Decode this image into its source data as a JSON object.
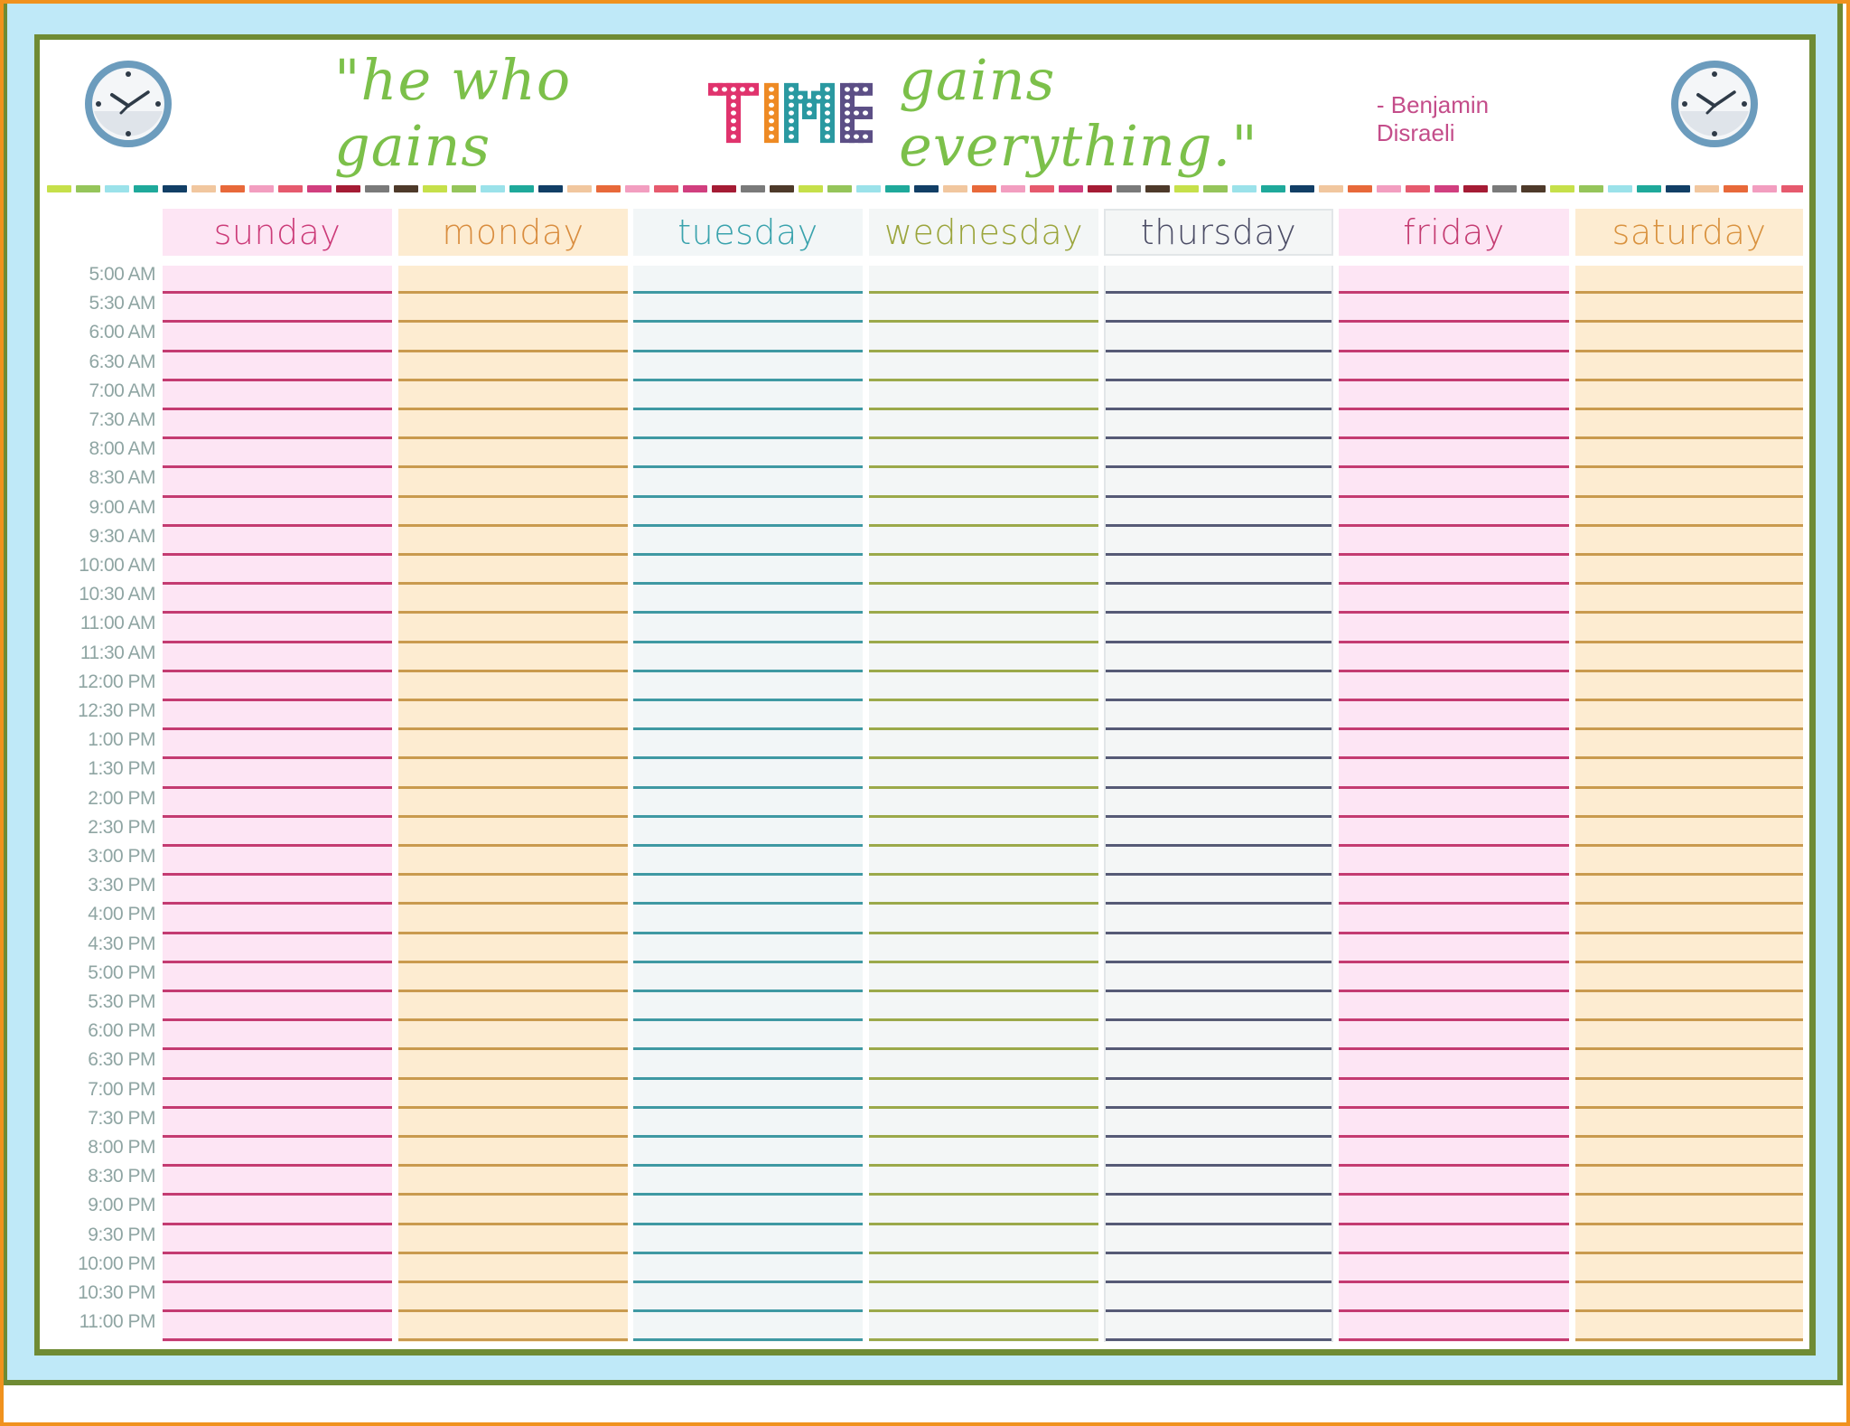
{
  "header": {
    "quote_before": "\"he who gains",
    "quote_emphasis": [
      "T",
      "I",
      "M",
      "E"
    ],
    "quote_emphasis_colors": [
      "#e0336d",
      "#ee8a24",
      "#2a99a1",
      "#5c4f86"
    ],
    "quote_after": "gains everything.\"",
    "author": "- Benjamin Disraeli",
    "clock_icon_left": "clock-icon",
    "clock_icon_right": "clock-icon"
  },
  "dash_colors": [
    "#c6e04a",
    "#95c55a",
    "#9be2ea",
    "#1fa99b",
    "#123f66",
    "#f1c79f",
    "#e8693a",
    "#f29ec0",
    "#e65a6e",
    "#d13f7f",
    "#a51c35",
    "#7a7a7a",
    "#4e3a2a"
  ],
  "days": [
    {
      "label": "sunday",
      "text_color": "#cc3c79",
      "bg": "#fde5f4",
      "line": "#c43b71",
      "header_border": false
    },
    {
      "label": "monday",
      "text_color": "#d98d3f",
      "bg": "#fdecd1",
      "line": "#c99a4e",
      "header_border": false
    },
    {
      "label": "tuesday",
      "text_color": "#3aa3ad",
      "bg": "#f2f6f7",
      "line": "#3f99a3",
      "header_border": false
    },
    {
      "label": "wednesday",
      "text_color": "#9ba53c",
      "bg": "#f3f6f6",
      "line": "#9ba94a",
      "header_border": false
    },
    {
      "label": "thursday",
      "text_color": "#4c4d66",
      "bg": "#f4f6f6",
      "line": "#565a76",
      "header_border": true
    },
    {
      "label": "friday",
      "text_color": "#c43b71",
      "bg": "#fde5f4",
      "line": "#c43b71",
      "header_border": false
    },
    {
      "label": "saturday",
      "text_color": "#d9923f",
      "bg": "#fdecd1",
      "line": "#c99a4e",
      "header_border": false
    }
  ],
  "times": [
    "5:00 AM",
    "5:30 AM",
    "6:00 AM",
    "6:30 AM",
    "7:00 AM",
    "7:30 AM",
    "8:00 AM",
    "8:30 AM",
    "9:00 AM",
    "9:30 AM",
    "10:00 AM",
    "10:30 AM",
    "11:00 AM",
    "11:30 AM",
    "12:00 PM",
    "12:30 PM",
    "1:00 PM",
    "1:30 PM",
    "2:00 PM",
    "2:30 PM",
    "3:00 PM",
    "3:30 PM",
    "4:00 PM",
    "4:30 PM",
    "5:00 PM",
    "5:30 PM",
    "6:00 PM",
    "6:30 PM",
    "7:00 PM",
    "7:30 PM",
    "8:00 PM",
    "8:30 PM",
    "9:00 PM",
    "9:30 PM",
    "10:00 PM",
    "10:30 PM",
    "11:00 PM"
  ]
}
